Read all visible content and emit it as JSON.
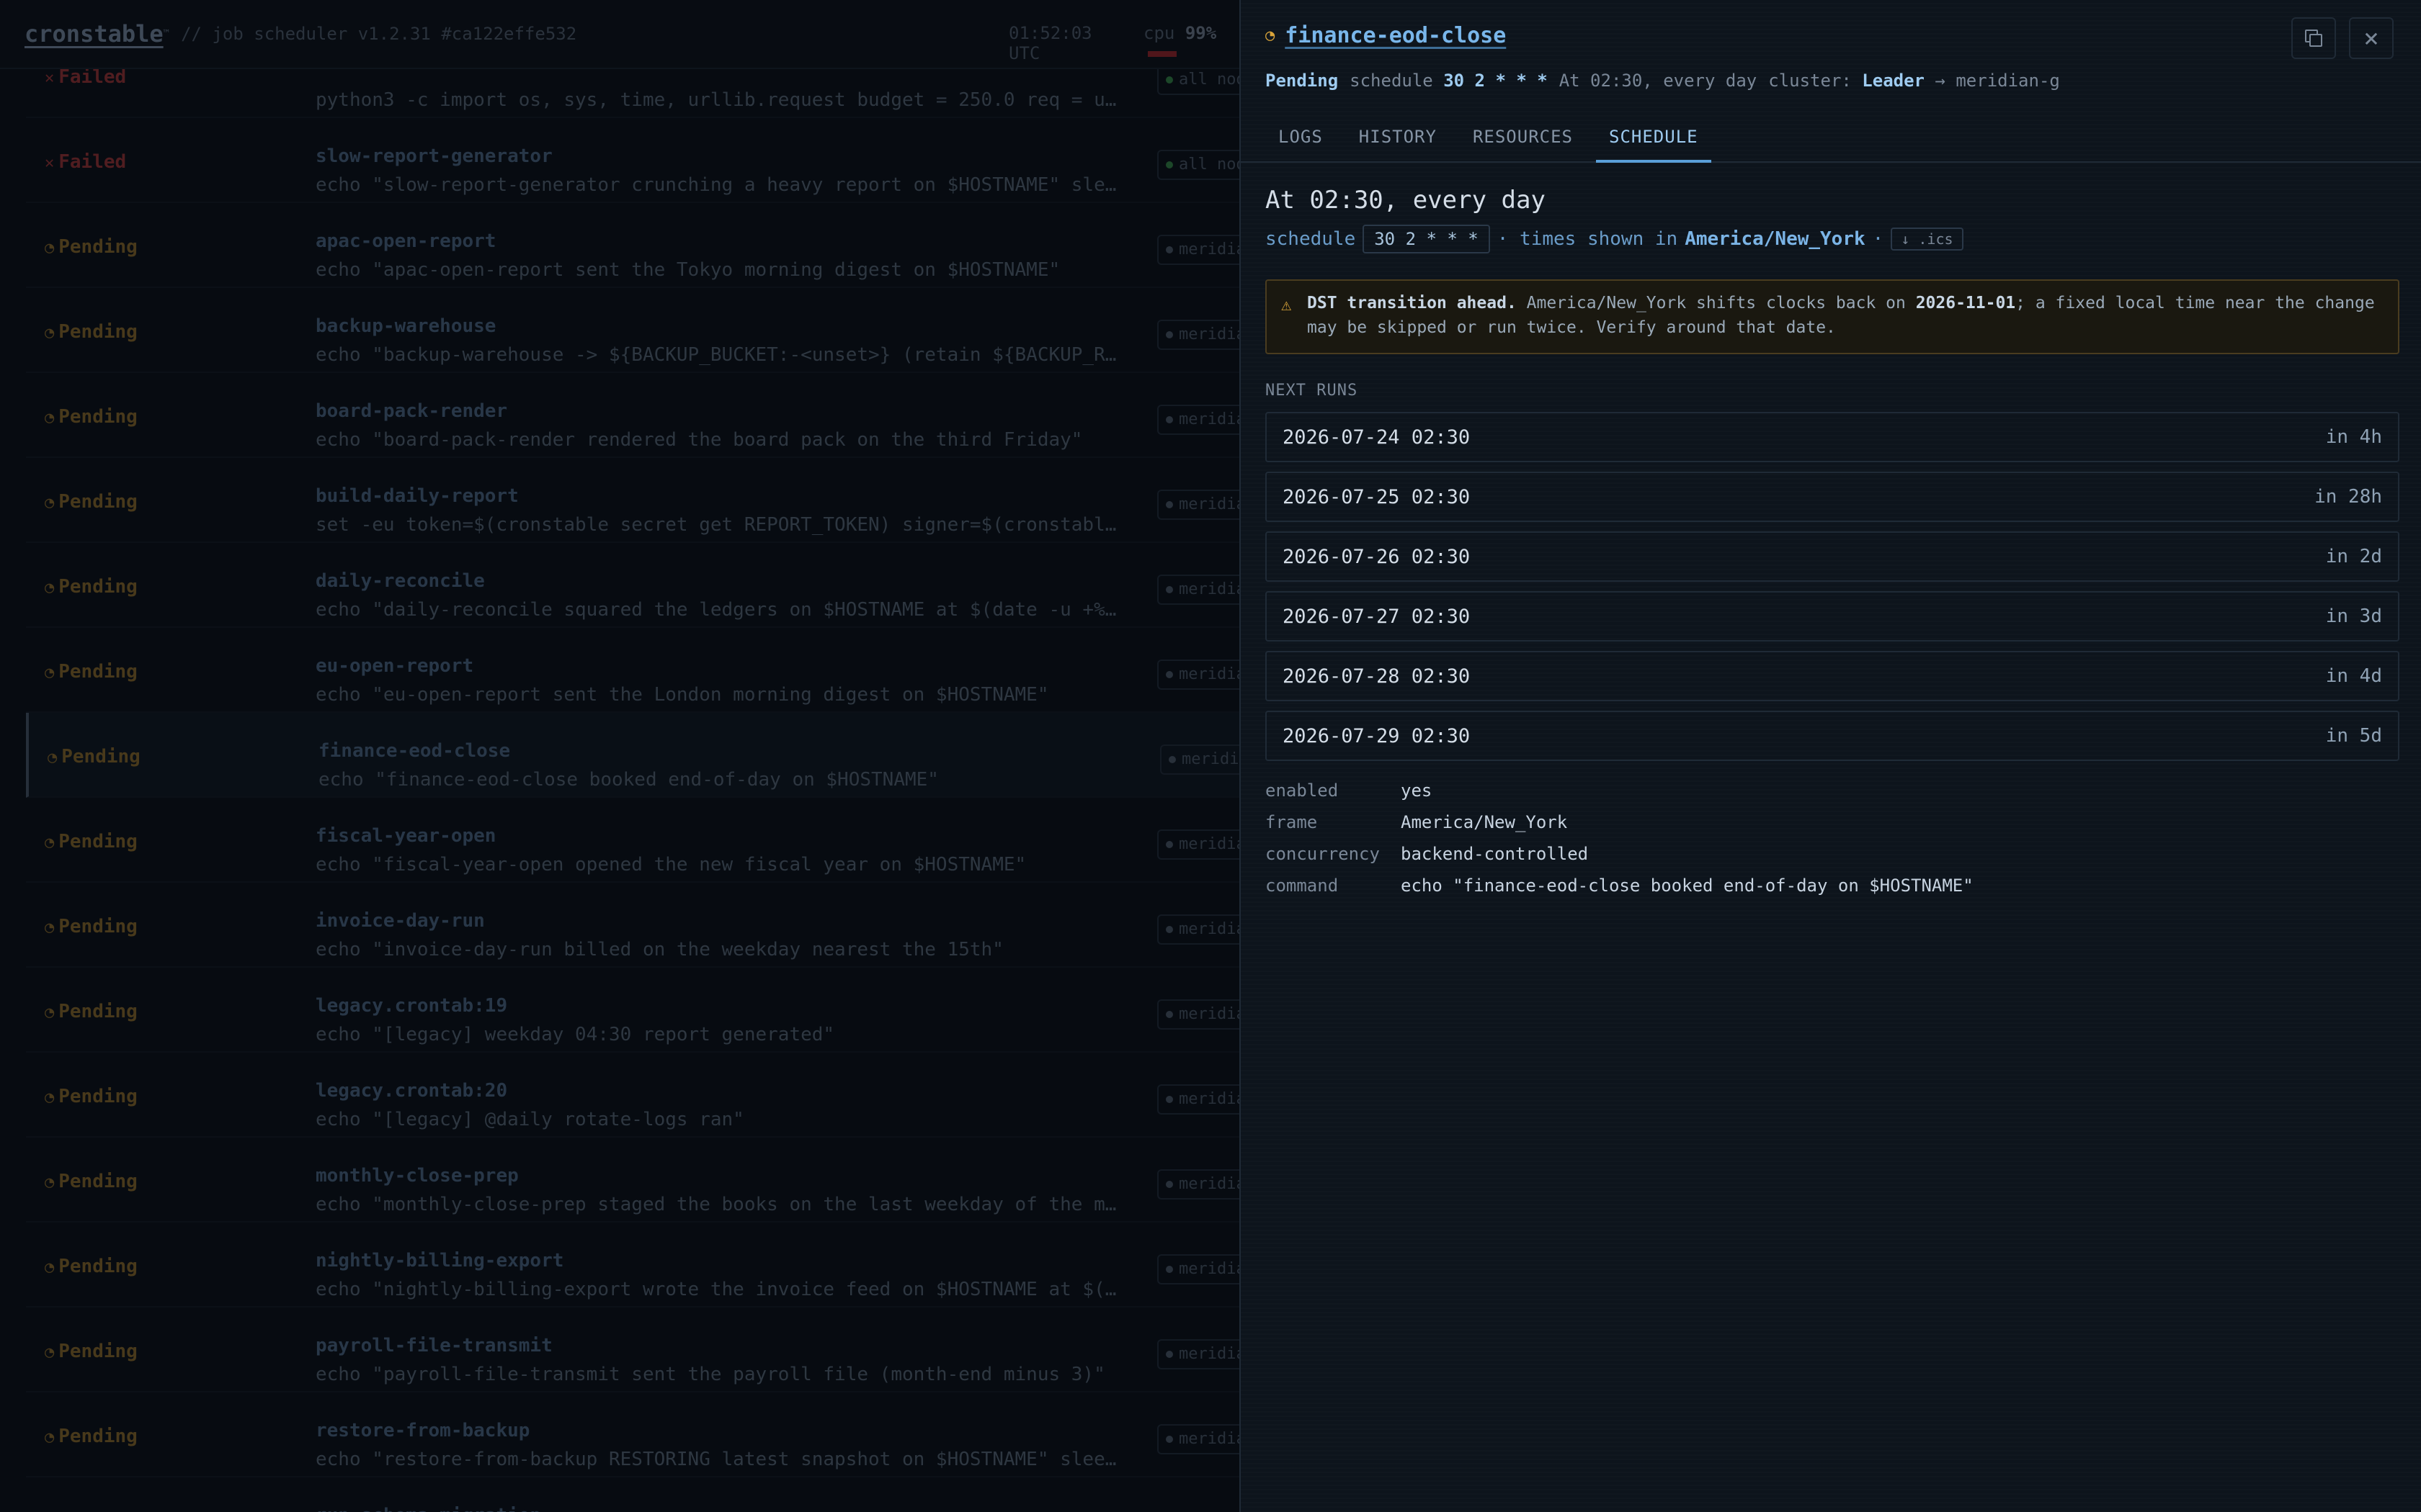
{
  "app": {
    "logo": "cronstable",
    "subtitle": "// job scheduler  v1.2.31  #ca122effe532",
    "clock": "01:52:03 UTC",
    "cpu_label": "cpu",
    "cpu_value": "99%"
  },
  "jobs": [
    {
      "status": "Failed",
      "name": "",
      "cmd": "python3 -c import os, sys, time, urllib.request budget = 250.0 req = u…",
      "tag": "all nodes",
      "tag_state": "ok"
    },
    {
      "status": "Failed",
      "name": "slow-report-generator",
      "cmd": "echo \"slow-report-generator crunching a heavy report on $HOSTNAME\" sle…",
      "tag": "all nodes",
      "tag_state": "ok"
    },
    {
      "status": "Pending",
      "name": "apac-open-report",
      "cmd": "echo \"apac-open-report sent the Tokyo morning digest on $HOSTNAME\"",
      "tag": "meridian-g",
      "tag_state": ""
    },
    {
      "status": "Pending",
      "name": "backup-warehouse",
      "cmd": "echo \"backup-warehouse -> ${BACKUP_BUCKET:-<unset>} (retain ${BACKUP_R…",
      "tag": "meridian-g",
      "tag_state": ""
    },
    {
      "status": "Pending",
      "name": "board-pack-render",
      "cmd": "echo \"board-pack-render rendered the board pack on the third Friday\"",
      "tag": "meridian-g",
      "tag_state": ""
    },
    {
      "status": "Pending",
      "name": "build-daily-report",
      "cmd": "set -eu token=$(cronstable secret get REPORT_TOKEN) signer=$(cronstabl…",
      "tag": "meridian-g",
      "tag_state": ""
    },
    {
      "status": "Pending",
      "name": "daily-reconcile",
      "cmd": "echo \"daily-reconcile squared the ledgers on $HOSTNAME at $(date -u +%…",
      "tag": "meridian-g",
      "tag_state": ""
    },
    {
      "status": "Pending",
      "name": "eu-open-report",
      "cmd": "echo \"eu-open-report sent the London morning digest on $HOSTNAME\"",
      "tag": "meridian-g",
      "tag_state": ""
    },
    {
      "status": "Pending",
      "name": "finance-eod-close",
      "cmd": "echo \"finance-eod-close booked end-of-day on $HOSTNAME\"",
      "tag": "meridian-g",
      "tag_state": "",
      "selected": true
    },
    {
      "status": "Pending",
      "name": "fiscal-year-open",
      "cmd": "echo \"fiscal-year-open opened the new fiscal year on $HOSTNAME\"",
      "tag": "meridian-g",
      "tag_state": ""
    },
    {
      "status": "Pending",
      "name": "invoice-day-run",
      "cmd": "echo \"invoice-day-run billed on the weekday nearest the 15th\"",
      "tag": "meridian-g",
      "tag_state": ""
    },
    {
      "status": "Pending",
      "name": "legacy.crontab:19",
      "cmd": "echo \"[legacy] weekday 04:30 report generated\"",
      "tag": "meridian-g",
      "tag_state": ""
    },
    {
      "status": "Pending",
      "name": "legacy.crontab:20",
      "cmd": "echo \"[legacy] @daily rotate-logs ran\"",
      "tag": "meridian-g",
      "tag_state": ""
    },
    {
      "status": "Pending",
      "name": "monthly-close-prep",
      "cmd": "echo \"monthly-close-prep staged the books on the last weekday of the m…",
      "tag": "meridian-g",
      "tag_state": ""
    },
    {
      "status": "Pending",
      "name": "nightly-billing-export",
      "cmd": "echo \"nightly-billing-export wrote the invoice feed on $HOSTNAME at $(…",
      "tag": "meridian-g",
      "tag_state": ""
    },
    {
      "status": "Pending",
      "name": "payroll-file-transmit",
      "cmd": "echo \"payroll-file-transmit sent the payroll file (month-end minus 3)\"",
      "tag": "meridian-g",
      "tag_state": ""
    },
    {
      "status": "Pending",
      "name": "restore-from-backup",
      "cmd": "echo \"restore-from-backup RESTORING latest snapshot on $HOSTNAME\" slee…",
      "tag": "meridian-g",
      "tag_state": ""
    },
    {
      "status": "",
      "name": "run-schema-migration",
      "cmd": "",
      "tag": "",
      "tag_state": ""
    }
  ],
  "drawer": {
    "title": "finance-eod-close",
    "meta": {
      "status": "Pending",
      "schedule_label": "schedule",
      "cron": "30 2 * * *",
      "human": "At 02:30, every day",
      "cluster_label": "cluster:",
      "cluster_role": "Leader",
      "cluster_target": "→ meridian-g"
    },
    "tabs": [
      "LOGS",
      "HISTORY",
      "RESOURCES",
      "SCHEDULE"
    ],
    "active_tab": "SCHEDULE",
    "schedule": {
      "heading": "At 02:30, every day",
      "label": "schedule",
      "cron": "30 2 * * *",
      "tz_prefix": "· times shown in",
      "tz": "America/New_York",
      "sep": "·",
      "ics": "↓ .ics"
    },
    "warning": {
      "strong": "DST transition ahead.",
      "text1": " America/New_York shifts clocks back on ",
      "date": "2026-11-01",
      "text2": "; a fixed local time near the change",
      "line2": "may be skipped or run twice. Verify around that date."
    },
    "next_runs_label": "NEXT RUNS",
    "next_runs": [
      {
        "when": "2026-07-24 02:30",
        "rel": "in 4h"
      },
      {
        "when": "2026-07-25 02:30",
        "rel": "in 28h"
      },
      {
        "when": "2026-07-26 02:30",
        "rel": "in 2d"
      },
      {
        "when": "2026-07-27 02:30",
        "rel": "in 3d"
      },
      {
        "when": "2026-07-28 02:30",
        "rel": "in 4d"
      },
      {
        "when": "2026-07-29 02:30",
        "rel": "in 5d"
      }
    ],
    "details": [
      {
        "k": "enabled",
        "v": "yes"
      },
      {
        "k": "frame",
        "v": "America/New_York"
      },
      {
        "k": "concurrency",
        "v": "backend-controlled"
      },
      {
        "k": "command",
        "v": "echo \"finance-eod-close booked end-of-day on $HOSTNAME\""
      }
    ]
  }
}
